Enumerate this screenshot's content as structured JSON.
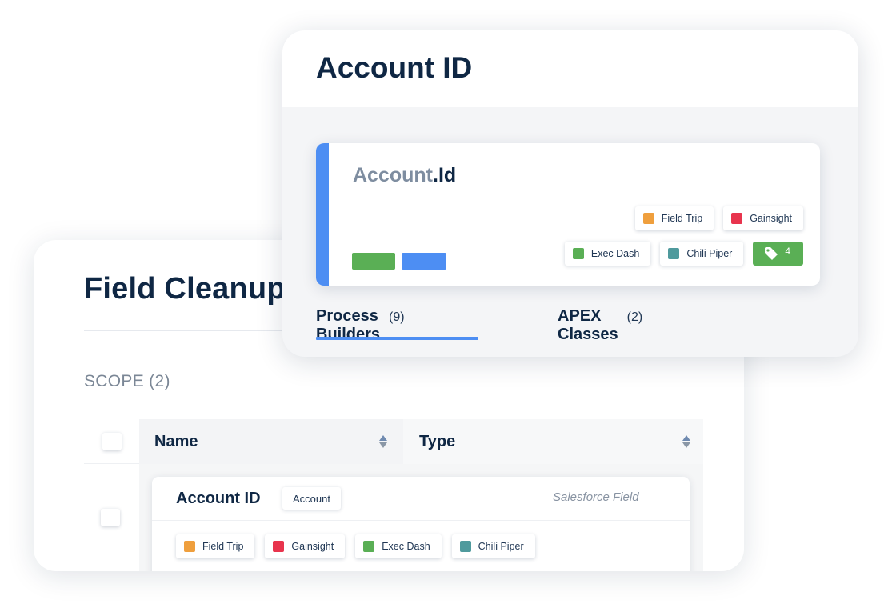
{
  "field_cleanup": {
    "title": "Field Cleanup",
    "scope_label": "SCOPE",
    "scope_count": "(2)",
    "table": {
      "columns": [
        {
          "label": "Name"
        },
        {
          "label": "Type"
        }
      ],
      "rows": [
        {
          "name": "Account ID",
          "object_badge": "Account",
          "type": "Salesforce Field",
          "tags": [
            {
              "label": "Field Trip",
              "color": "#ef9f3d"
            },
            {
              "label": "Gainsight",
              "color": "#e8344d"
            },
            {
              "label": "Exec Dash",
              "color": "#5aaf55"
            },
            {
              "label": "Chili Piper",
              "color": "#4f9a9d"
            }
          ]
        }
      ]
    }
  },
  "account_detail": {
    "title": "Account ID",
    "field": {
      "object": "Account",
      "api_name": ".Id",
      "accent_color": "#4d8ef3",
      "pills": [
        {
          "color": "#5aaf55"
        },
        {
          "color": "#4d8ef3"
        }
      ],
      "tags_row1": [
        {
          "label": "Field Trip",
          "color": "#ef9f3d"
        },
        {
          "label": "Gainsight",
          "color": "#e8344d"
        }
      ],
      "tags_row2": [
        {
          "label": "Exec Dash",
          "color": "#5aaf55"
        },
        {
          "label": "Chili Piper",
          "color": "#4f9a9d"
        }
      ],
      "tag_count": "4",
      "tag_count_icon": "tag-icon"
    },
    "tabs": [
      {
        "label": "Process Builders",
        "count": "(9)",
        "active": true
      },
      {
        "label": "APEX Classes",
        "count": "(2)",
        "active": false
      }
    ]
  }
}
